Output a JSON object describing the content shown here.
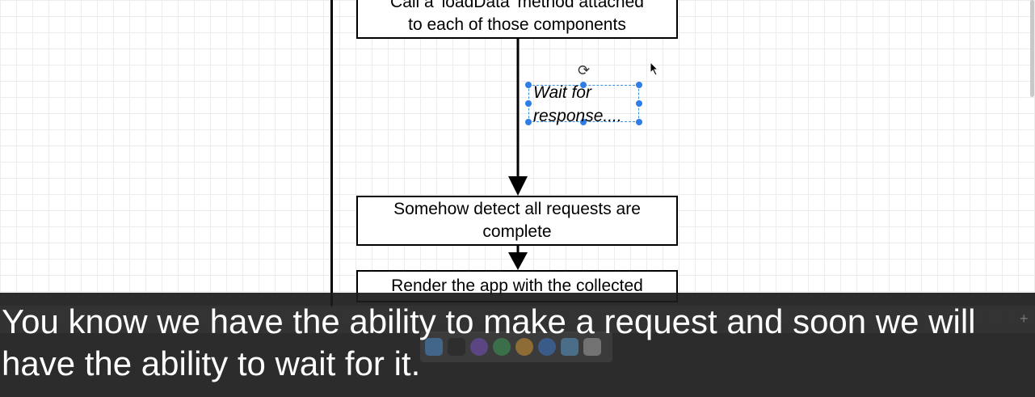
{
  "diagram": {
    "box_top_lines": [
      "Call a 'loadData' method attached",
      "to each of those components"
    ],
    "wait_label_lines": [
      "Wait for",
      "response...."
    ],
    "box_middle": "Somehow detect all requests are complete",
    "box_bottom": "Render the app with the collected"
  },
  "captions": {
    "line1": "You know we have the ability to make a request and soon we will",
    "line2": "have the ability to wait for it."
  },
  "colors": {
    "selection": "#2f7ee8",
    "caption_bg": "#1c1c1c",
    "grid": "#ececec"
  },
  "icons": [
    "rotate-handle-icon",
    "mouse-pointer-icon",
    "add-tab-icon"
  ]
}
